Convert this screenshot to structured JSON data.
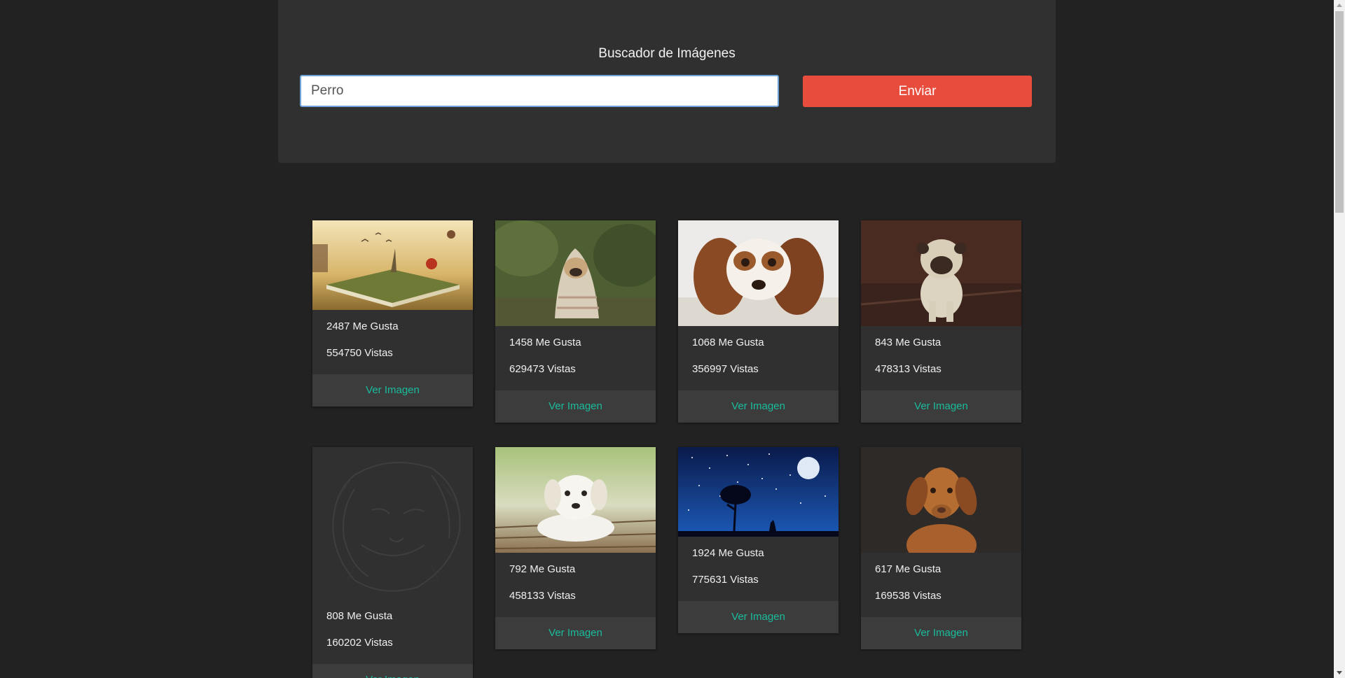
{
  "search": {
    "title": "Buscador de Imágenes",
    "value": "Perro",
    "button_label": "Enviar"
  },
  "colors": {
    "background": "#222222",
    "panel": "#303030",
    "button": "#e74c3c",
    "link": "#1abc9c"
  },
  "cards": [
    {
      "likes": "2487 Me Gusta",
      "views": "554750 Vistas",
      "link": "Ver Imagen",
      "image": "book-landscape-image"
    },
    {
      "likes": "1458 Me Gusta",
      "views": "629473 Vistas",
      "link": "Ver Imagen",
      "image": "pug-in-blanket-image"
    },
    {
      "likes": "1068 Me Gusta",
      "views": "356997 Vistas",
      "link": "Ver Imagen",
      "image": "spaniel-lying-image"
    },
    {
      "likes": "843 Me Gusta",
      "views": "478313 Vistas",
      "link": "Ver Imagen",
      "image": "pug-standing-image"
    },
    {
      "likes": "808 Me Gusta",
      "views": "160202 Vistas",
      "link": "Ver Imagen",
      "image": "dog-sketch-image"
    },
    {
      "likes": "792 Me Gusta",
      "views": "458133 Vistas",
      "link": "Ver Imagen",
      "image": "white-puppy-image"
    },
    {
      "likes": "1924 Me Gusta",
      "views": "775631 Vistas",
      "link": "Ver Imagen",
      "image": "night-wolf-moon-image"
    },
    {
      "likes": "617 Me Gusta",
      "views": "169538 Vistas",
      "link": "Ver Imagen",
      "image": "vizsla-dog-image"
    }
  ]
}
